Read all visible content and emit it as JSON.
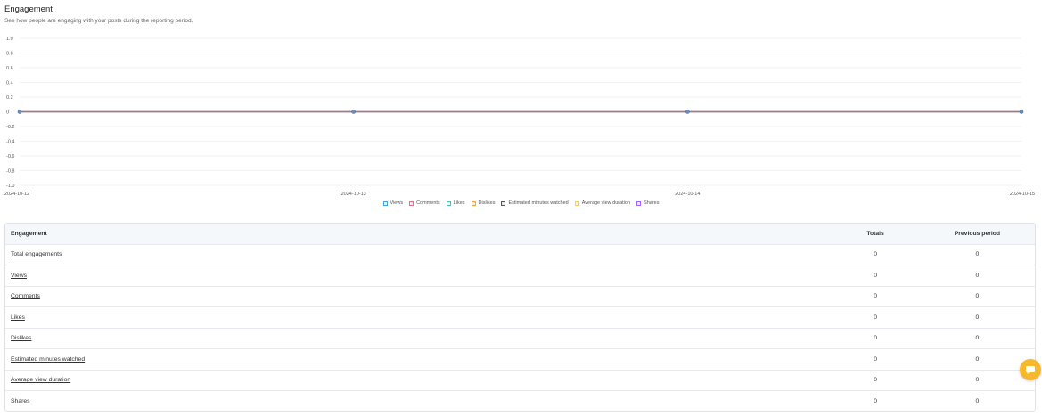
{
  "header": {
    "title": "Engagement",
    "subtitle": "See how people are engaging with your posts during the reporting period."
  },
  "chart_data": {
    "type": "line",
    "x": [
      "2024-10-12",
      "2024-10-13",
      "2024-10-14",
      "2024-10-15"
    ],
    "y_ticks": [
      "1.0",
      "0.8",
      "0.6",
      "0.4",
      "0.2",
      "0",
      "-0.2",
      "-0.4",
      "-0.6",
      "-0.8",
      "-1.0"
    ],
    "ylim": [
      -1.0,
      1.0
    ],
    "grid": true,
    "legend_placement": "bottom",
    "series": [
      {
        "name": "Views",
        "values": [
          0,
          0,
          0,
          0
        ],
        "color": "#4aa3df"
      },
      {
        "name": "Comments",
        "values": [
          0,
          0,
          0,
          0
        ],
        "color": "#f06a8a"
      },
      {
        "name": "Likes",
        "values": [
          0,
          0,
          0,
          0
        ],
        "color": "#4bc0c0"
      },
      {
        "name": "Dislikes",
        "values": [
          0,
          0,
          0,
          0
        ],
        "color": "#ff9f40"
      },
      {
        "name": "Estimated minutes watched",
        "values": [
          0,
          0,
          0,
          0
        ],
        "color": "#555555"
      },
      {
        "name": "Average view duration",
        "values": [
          0,
          0,
          0,
          0
        ],
        "color": "#ffcd56"
      },
      {
        "name": "Shares",
        "values": [
          0,
          0,
          0,
          0
        ],
        "color": "#9966ff"
      }
    ]
  },
  "table": {
    "headers": [
      "Engagement",
      "Totals",
      "Previous period"
    ],
    "rows": [
      {
        "label": "Total engagements",
        "total": "0",
        "previous": "0"
      },
      {
        "label": "Views",
        "total": "0",
        "previous": "0"
      },
      {
        "label": "Comments",
        "total": "0",
        "previous": "0"
      },
      {
        "label": "Likes",
        "total": "0",
        "previous": "0"
      },
      {
        "label": "Dislikes",
        "total": "0",
        "previous": "0"
      },
      {
        "label": "Estimated minutes watched",
        "total": "0",
        "previous": "0"
      },
      {
        "label": "Average view duration",
        "total": "0",
        "previous": "0"
      },
      {
        "label": "Shares",
        "total": "0",
        "previous": "0"
      }
    ]
  },
  "fab": {
    "icon": "chat-icon",
    "color": "#f5b82e"
  }
}
